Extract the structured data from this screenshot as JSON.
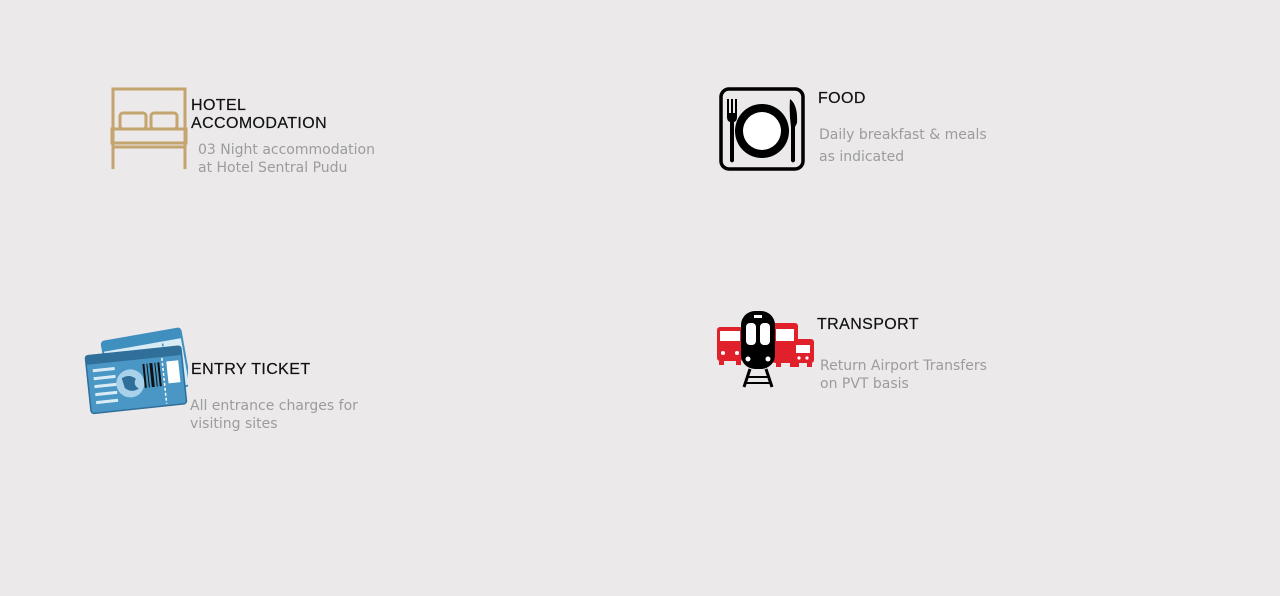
{
  "features": {
    "hotel": {
      "icon": "bed-icon",
      "title_line1": "HOTEL",
      "title_line2": "ACCOMODATION",
      "desc_line1": "03 Night accommodation",
      "desc_line2": "at Hotel Sentral Pudu",
      "color": "#c4a46f"
    },
    "food": {
      "icon": "plate-cutlery-icon",
      "title": "FOOD",
      "desc_line1": "Daily breakfast & meals",
      "desc_line2": "as indicated",
      "color": "#000000"
    },
    "ticket": {
      "icon": "ticket-icon",
      "title": "ENTRY TICKET",
      "desc_line1": "All entrance charges for",
      "desc_line2": "visiting sites",
      "color": "#3f8fbf"
    },
    "transport": {
      "icon": "transport-icon",
      "title": "TRANSPORT",
      "desc_line1": "Return Airport Transfers",
      "desc_line2": "on PVT basis",
      "color": "#e0202b"
    }
  }
}
